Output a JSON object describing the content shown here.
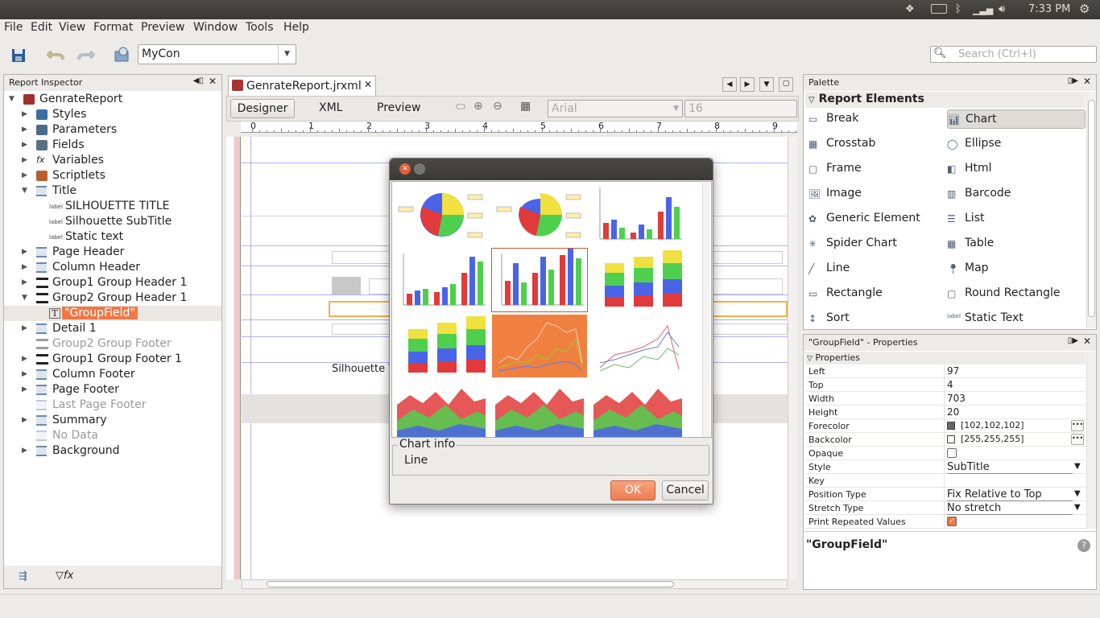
{
  "topbar": {
    "clock": "7:33 PM"
  },
  "menu": [
    "File",
    "Edit",
    "View",
    "Format",
    "Preview",
    "Window",
    "Tools",
    "Help"
  ],
  "toolbar": {
    "connection": "MyCon",
    "search_placeholder": "Search (Ctrl+I)"
  },
  "inspector": {
    "title": "Report Inspector",
    "items": [
      {
        "label": "GenrateReport",
        "icon": "report-icon",
        "level": 0,
        "arrow": "open"
      },
      {
        "label": "Styles",
        "icon": "styles-icon",
        "level": 1,
        "arrow": "closed"
      },
      {
        "label": "Parameters",
        "icon": "parameters-icon",
        "level": 1,
        "arrow": "closed"
      },
      {
        "label": "Fields",
        "icon": "fields-icon",
        "level": 1,
        "arrow": "closed"
      },
      {
        "label": "Variables",
        "icon": "variables-icon",
        "level": 1,
        "arrow": "closed"
      },
      {
        "label": "Scriptlets",
        "icon": "scriptlets-icon",
        "level": 1,
        "arrow": "closed"
      },
      {
        "label": "Title",
        "icon": "band-icon",
        "level": 1,
        "arrow": "open"
      },
      {
        "label": "SILHOUETTE TITLE",
        "icon": "label-icon",
        "level": 2,
        "arrow": ""
      },
      {
        "label": "Silhouette SubTitle",
        "icon": "label-icon",
        "level": 2,
        "arrow": ""
      },
      {
        "label": "Static text",
        "icon": "label-icon",
        "level": 2,
        "arrow": ""
      },
      {
        "label": "Page Header",
        "icon": "band-icon",
        "level": 1,
        "arrow": "closed"
      },
      {
        "label": "Column Header",
        "icon": "band-icon",
        "level": 1,
        "arrow": "closed"
      },
      {
        "label": "Group1 Group Header 1",
        "icon": "group-band-icon",
        "level": 1,
        "arrow": "closed"
      },
      {
        "label": "Group2 Group Header 1",
        "icon": "group-band-icon",
        "level": 1,
        "arrow": "open"
      },
      {
        "label": "\"GroupField\"",
        "icon": "textfield-icon",
        "level": 2,
        "arrow": "",
        "selected": true
      },
      {
        "label": "Detail 1",
        "icon": "band-icon",
        "level": 1,
        "arrow": "closed"
      },
      {
        "label": "Group2 Group Footer",
        "icon": "group-band-icon",
        "level": 1,
        "arrow": "",
        "muted": true
      },
      {
        "label": "Group1 Group Footer 1",
        "icon": "group-band-icon",
        "level": 1,
        "arrow": "closed"
      },
      {
        "label": "Column Footer",
        "icon": "band-icon",
        "level": 1,
        "arrow": "closed"
      },
      {
        "label": "Page Footer",
        "icon": "band-icon",
        "level": 1,
        "arrow": "closed"
      },
      {
        "label": "Last Page Footer",
        "icon": "band-icon",
        "level": 1,
        "arrow": "",
        "muted": true
      },
      {
        "label": "Summary",
        "icon": "band-icon",
        "level": 1,
        "arrow": "closed"
      },
      {
        "label": "No Data",
        "icon": "band-icon",
        "level": 1,
        "arrow": "",
        "muted": true
      },
      {
        "label": "Background",
        "icon": "band-icon",
        "level": 1,
        "arrow": "closed"
      }
    ]
  },
  "editor": {
    "tab": "GenrateReport.jrxml",
    "modes": [
      "Designer",
      "XML",
      "Preview"
    ],
    "font_name": "Arial",
    "font_size": "16",
    "ruler_numbers": [
      "0",
      "1",
      "2",
      "3",
      "4",
      "5",
      "6",
      "7",
      "8",
      "9"
    ],
    "canvas_text": "Silhouette T"
  },
  "dialog": {
    "chart_info_legend": "Chart info",
    "chart_info_value": "Line",
    "ok": "OK",
    "cancel": "Cancel",
    "selected_index": 4,
    "thumbnails": [
      "pie-chart-icon",
      "pie-3d-chart-icon",
      "bar-chart-icon",
      "bar-3d-chart-icon",
      "bar-xy-chart-icon",
      "stacked-bar-chart-icon",
      "stacked-bar-3d-chart-icon",
      "line-chart-icon",
      "xy-line-chart-icon",
      "area-chart-icon",
      "stacked-area-chart-icon",
      "xy-area-chart-icon"
    ]
  },
  "palette": {
    "title": "Palette",
    "section": "Report Elements",
    "left": [
      "Break",
      "Crosstab",
      "Frame",
      "Image",
      "Generic Element",
      "Spider Chart",
      "Line",
      "Rectangle",
      "Sort"
    ],
    "right": [
      "Chart",
      "Ellipse",
      "Html",
      "Barcode",
      "List",
      "Table",
      "Map",
      "Round Rectangle",
      "Static Text"
    ]
  },
  "properties": {
    "title": "\"GroupField\" - Properties",
    "section": "Properties",
    "rows": [
      {
        "key": "Left",
        "value": "97"
      },
      {
        "key": "Top",
        "value": "4"
      },
      {
        "key": "Width",
        "value": "703"
      },
      {
        "key": "Height",
        "value": "20"
      },
      {
        "key": "Forecolor",
        "value": "[102,102,102]",
        "swatch": "#666666"
      },
      {
        "key": "Backcolor",
        "value": "[255,255,255]",
        "swatch": "#ffffff"
      },
      {
        "key": "Opaque",
        "value": ""
      },
      {
        "key": "Style",
        "value": "SubTitle"
      },
      {
        "key": "Key",
        "value": ""
      },
      {
        "key": "Position Type",
        "value": "Fix Relative to Top"
      },
      {
        "key": "Stretch Type",
        "value": "No stretch"
      },
      {
        "key": "Print Repeated Values",
        "value": ""
      }
    ],
    "footer": "\"GroupField\""
  }
}
